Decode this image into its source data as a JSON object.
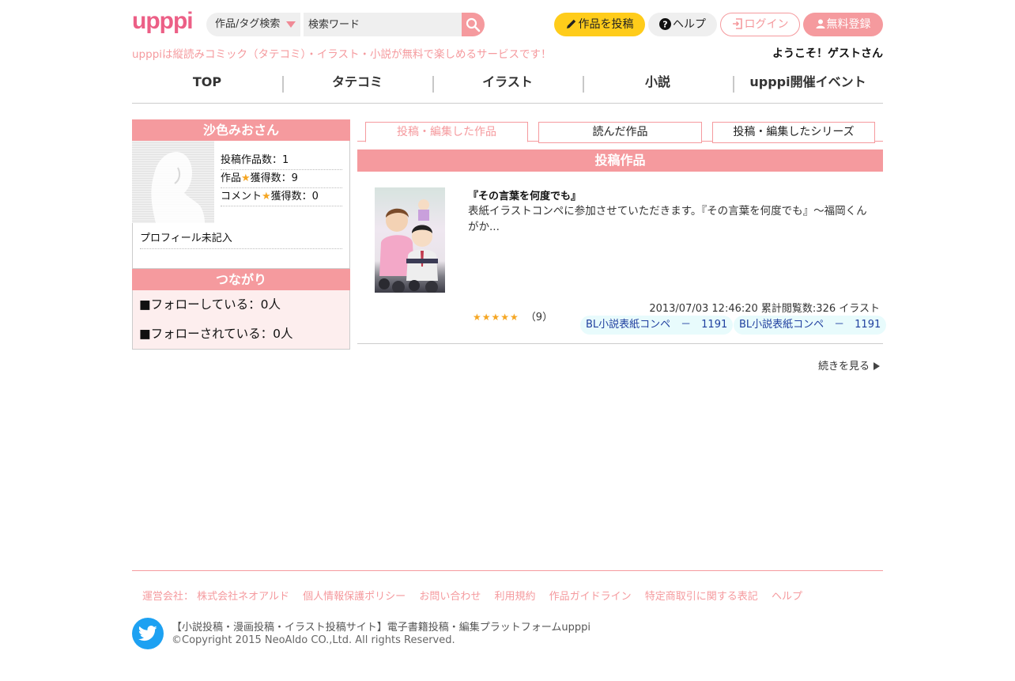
{
  "header": {
    "logo": "upppi",
    "search_type": "作品/タグ検索",
    "search_placeholder": "検索ワード",
    "post_button": "作品を投稿",
    "help_button": "ヘルプ",
    "login_button": "ログイン",
    "register_button": "無料登録",
    "tagline": "upppiは縦読みコミック（タテコミ）・イラスト・小説が無料で楽しめるサービスです！",
    "welcome": "ようこそ！ゲストさん"
  },
  "nav": [
    {
      "label": "TOP"
    },
    {
      "label": "タテコミ"
    },
    {
      "label": "イラスト"
    },
    {
      "label": "小説"
    },
    {
      "label": "upppi開催イベント"
    }
  ],
  "sidebar": {
    "user_name": "沙色みおさん",
    "stat_works": "投稿作品数：1",
    "stat_work_stars_prefix": "作品",
    "stat_work_stars_suffix": "獲得数：9",
    "stat_comment_stars_prefix": "コメント",
    "stat_comment_stars_suffix": "獲得数：0",
    "profile_text": "プロフィール未記入",
    "connections_title": "つながり",
    "following": "■フォローしている：0人",
    "followers": "■フォローされている：0人"
  },
  "tabs": [
    {
      "label": "投稿・編集した作品",
      "active": true
    },
    {
      "label": "読んだ作品",
      "active": false
    },
    {
      "label": "投稿・編集したシリーズ",
      "active": false
    }
  ],
  "section_title": "投稿作品",
  "work": {
    "title": "『その言葉を何度でも』",
    "description": "表紙イラストコンペに参加させていただきます。『その言葉を何度でも』～福岡くんがか...",
    "stars": 5,
    "rating_count": "（9）",
    "meta": "2013/07/03 12:46:20 累計閲覧数:326 イラスト",
    "tags": [
      "BL小説表紙コンペ　－　1191",
      "BL小説表紙コンペ　－　1191"
    ]
  },
  "more_link": "続きを見る",
  "footer": {
    "links": [
      "運営会社： 株式会社ネオアルド",
      "個人情報保護ポリシー",
      "お問い合わせ",
      "利用規約",
      "作品ガイドライン",
      "特定商取引に関する表記",
      "ヘルプ"
    ],
    "site_desc": "【小説投稿・漫画投稿・イラスト投稿サイト】電子書籍投稿・編集プラットフォームupppi",
    "copyright": "©Copyright 2015 NeoAldo CO.,Ltd. All rights Reserved."
  },
  "colors": {
    "accent": "#f59a9e",
    "logo": "#ec5f86",
    "post_button": "#ffcc1a",
    "tag_text": "#1f3f9f"
  }
}
